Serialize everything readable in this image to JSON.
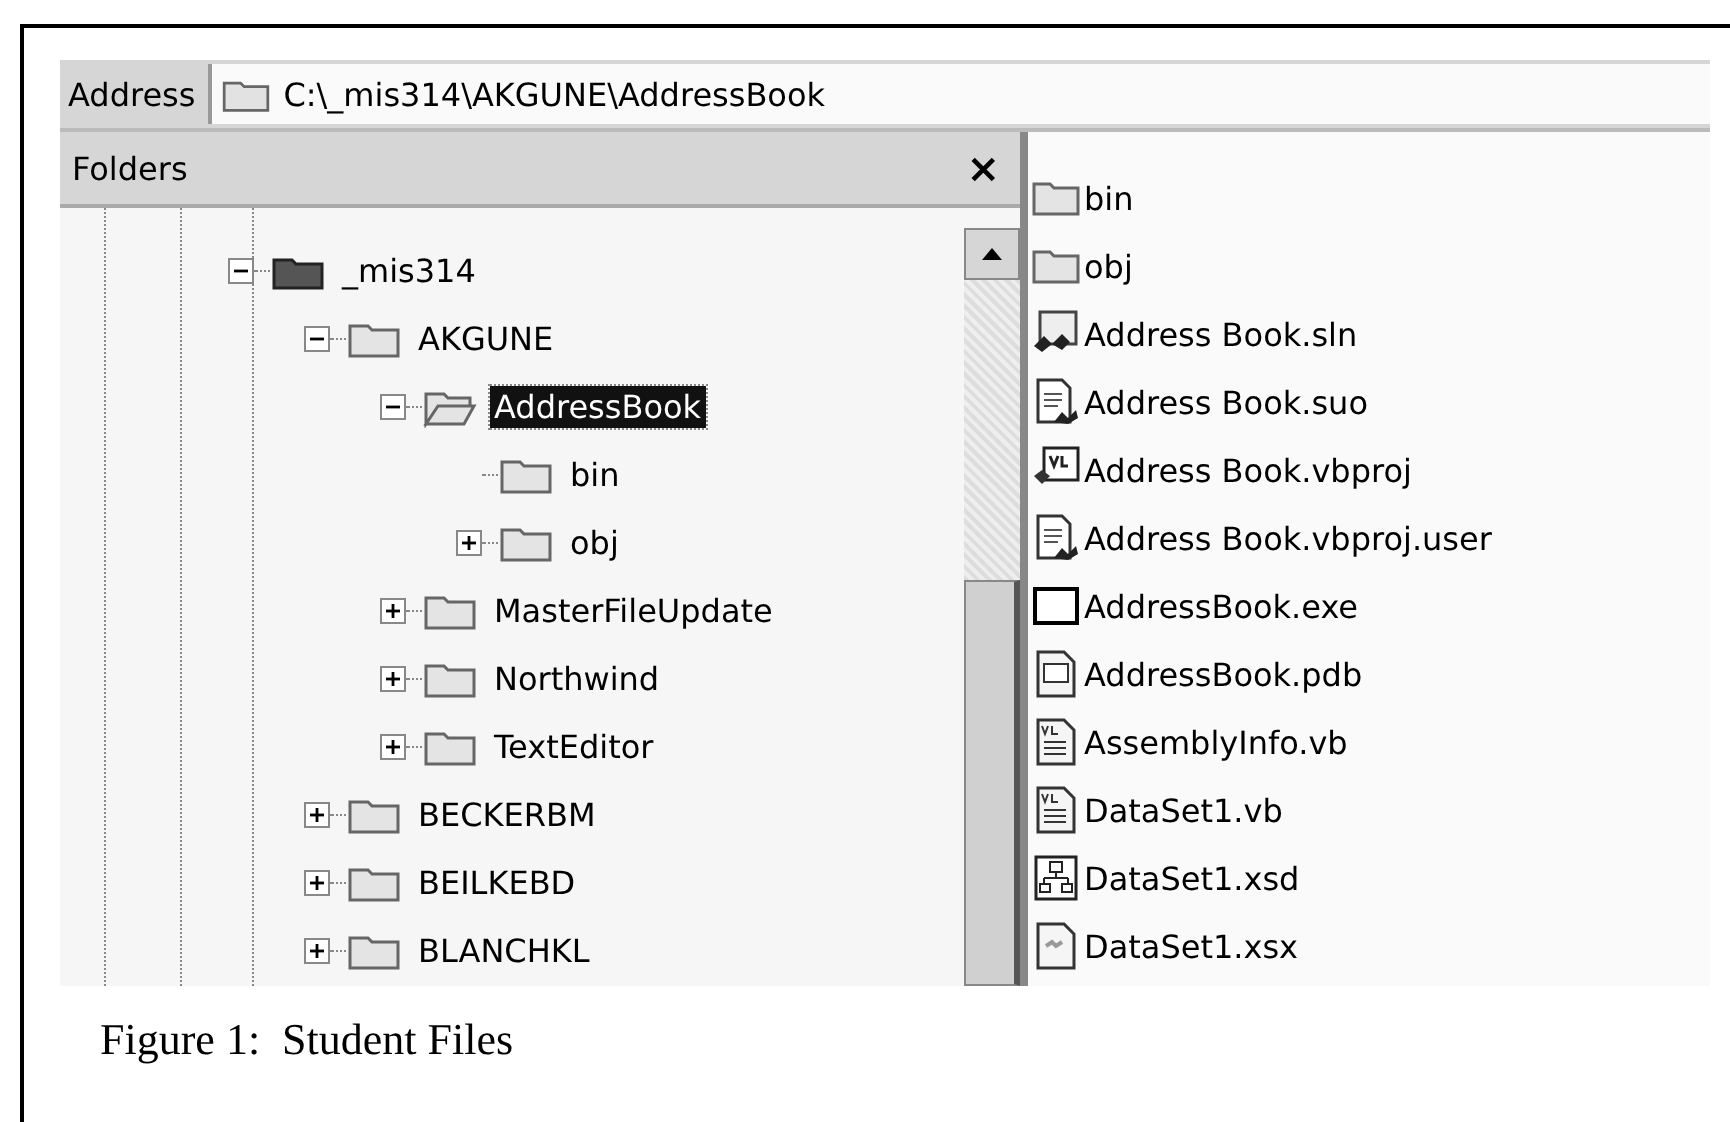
{
  "address_bar": {
    "label": "Address",
    "path": "C:\\_mis314\\AKGUNE\\AddressBook"
  },
  "folders_pane": {
    "title": "Folders",
    "close": "×",
    "tree": [
      {
        "label": "_mis314",
        "kind": "drive",
        "expanded": true,
        "selected": false,
        "children": [
          {
            "label": "AKGUNE",
            "kind": "folder",
            "expanded": true,
            "selected": false,
            "children": [
              {
                "label": "AddressBook",
                "kind": "open-folder",
                "expanded": true,
                "selected": true,
                "children": [
                  {
                    "label": "bin",
                    "kind": "folder",
                    "selected": false
                  },
                  {
                    "label": "obj",
                    "kind": "folder",
                    "expanded": false,
                    "selected": false
                  }
                ]
              },
              {
                "label": "MasterFileUpdate",
                "kind": "folder",
                "expanded": false,
                "selected": false
              },
              {
                "label": "Northwind",
                "kind": "folder",
                "expanded": false,
                "selected": false
              },
              {
                "label": "TextEditor",
                "kind": "folder",
                "expanded": false,
                "selected": false
              }
            ]
          },
          {
            "label": "BECKERBM",
            "kind": "folder",
            "expanded": false,
            "selected": false
          },
          {
            "label": "BEILKEBD",
            "kind": "folder",
            "expanded": false,
            "selected": false
          },
          {
            "label": "BLANCHKL",
            "kind": "folder",
            "expanded": false,
            "selected": false
          }
        ]
      }
    ]
  },
  "files": [
    {
      "name": "bin",
      "kind": "folder"
    },
    {
      "name": "obj",
      "kind": "folder"
    },
    {
      "name": "Address Book.sln",
      "kind": "solution"
    },
    {
      "name": "Address Book.suo",
      "kind": "options"
    },
    {
      "name": "Address Book.vbproj",
      "kind": "vbproj"
    },
    {
      "name": "Address Book.vbproj.user",
      "kind": "options"
    },
    {
      "name": "AddressBook.exe",
      "kind": "exe"
    },
    {
      "name": "AddressBook.pdb",
      "kind": "pdb"
    },
    {
      "name": "AssemblyInfo.vb",
      "kind": "vb"
    },
    {
      "name": "DataSet1.vb",
      "kind": "vb"
    },
    {
      "name": "DataSet1.xsd",
      "kind": "xsd"
    },
    {
      "name": "DataSet1.xsx",
      "kind": "xsx"
    }
  ],
  "caption": "Figure 1:  Student Files"
}
